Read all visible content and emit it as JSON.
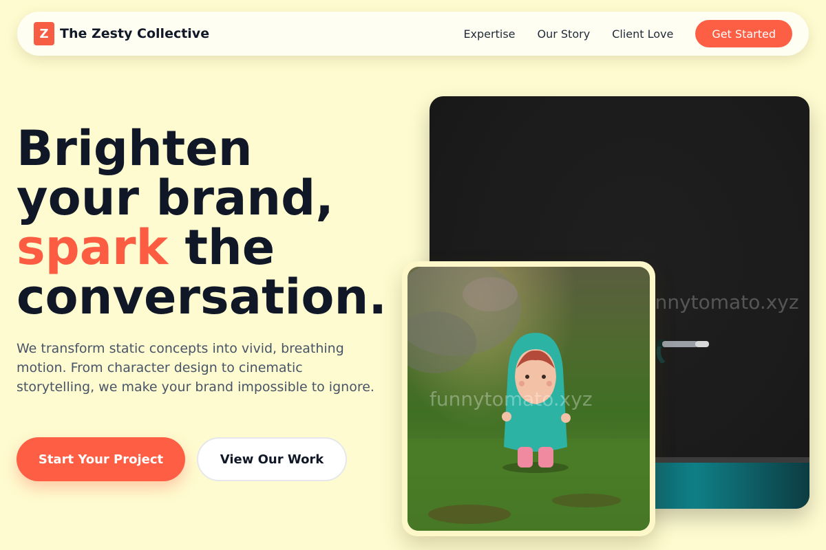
{
  "header": {
    "logo_letter": "Z",
    "brand": "The Zesty Collective",
    "nav": [
      "Expertise",
      "Our Story",
      "Client Love"
    ],
    "cta": "Get Started"
  },
  "hero": {
    "headline_line1": "Brighten",
    "headline_line2": "your brand,",
    "headline_accent": "spark",
    "headline_line3_rest": " the",
    "headline_line4": "conversation.",
    "subtext": "We transform static concepts into vivid, breathing motion. From character design to cinematic storytelling, we make your brand impossible to ignore.",
    "primary_button": "Start Your Project",
    "secondary_button": "View Our Work"
  },
  "media": {
    "video_watermark": "funnytomato.xyz",
    "photo_watermark": "funnytomato.xyz"
  },
  "colors": {
    "background": "#fefbd0",
    "accent": "#fd5e44",
    "text_dark": "#101828"
  }
}
